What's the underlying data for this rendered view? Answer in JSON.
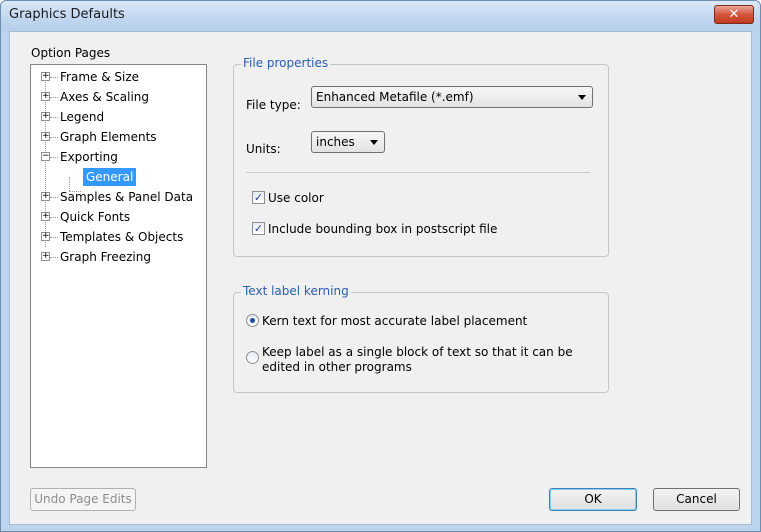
{
  "window": {
    "title": "Graphics Defaults",
    "close_glyph": "✕"
  },
  "option_pages": {
    "label": "Option Pages",
    "items": [
      {
        "label": "Frame & Size",
        "expander": "+"
      },
      {
        "label": "Axes & Scaling",
        "expander": "+"
      },
      {
        "label": "Legend",
        "expander": "+"
      },
      {
        "label": "Graph Elements",
        "expander": "+"
      },
      {
        "label": "Exporting",
        "expander": "−"
      },
      {
        "label": "General",
        "selected": true
      },
      {
        "label": "Samples & Panel Data",
        "expander": "+"
      },
      {
        "label": "Quick Fonts",
        "expander": "+"
      },
      {
        "label": "Templates & Objects",
        "expander": "+"
      },
      {
        "label": "Graph Freezing",
        "expander": "+"
      }
    ]
  },
  "file_properties": {
    "legend": "File properties",
    "file_type_label": "File type:",
    "file_type_value": "Enhanced Metafile (*.emf)",
    "units_label": "Units:",
    "units_value": "inches",
    "use_color_label": "Use color",
    "use_color_checked": "✓",
    "bounding_box_label": "Include bounding box in postscript file",
    "bounding_box_checked": "✓"
  },
  "text_label_kerning": {
    "legend": "Text label kerning",
    "option1": "Kern text for most accurate label placement",
    "option2_line1": "Keep label as a single block of text so that it can be",
    "option2_line2": "edited in other programs",
    "selected": "option1"
  },
  "buttons": {
    "undo": "Undo Page Edits",
    "ok": "OK",
    "cancel": "Cancel"
  },
  "colors": {
    "accent": "#3399ff",
    "group_legend": "#2a5dad",
    "close_button": "#c13a20"
  }
}
